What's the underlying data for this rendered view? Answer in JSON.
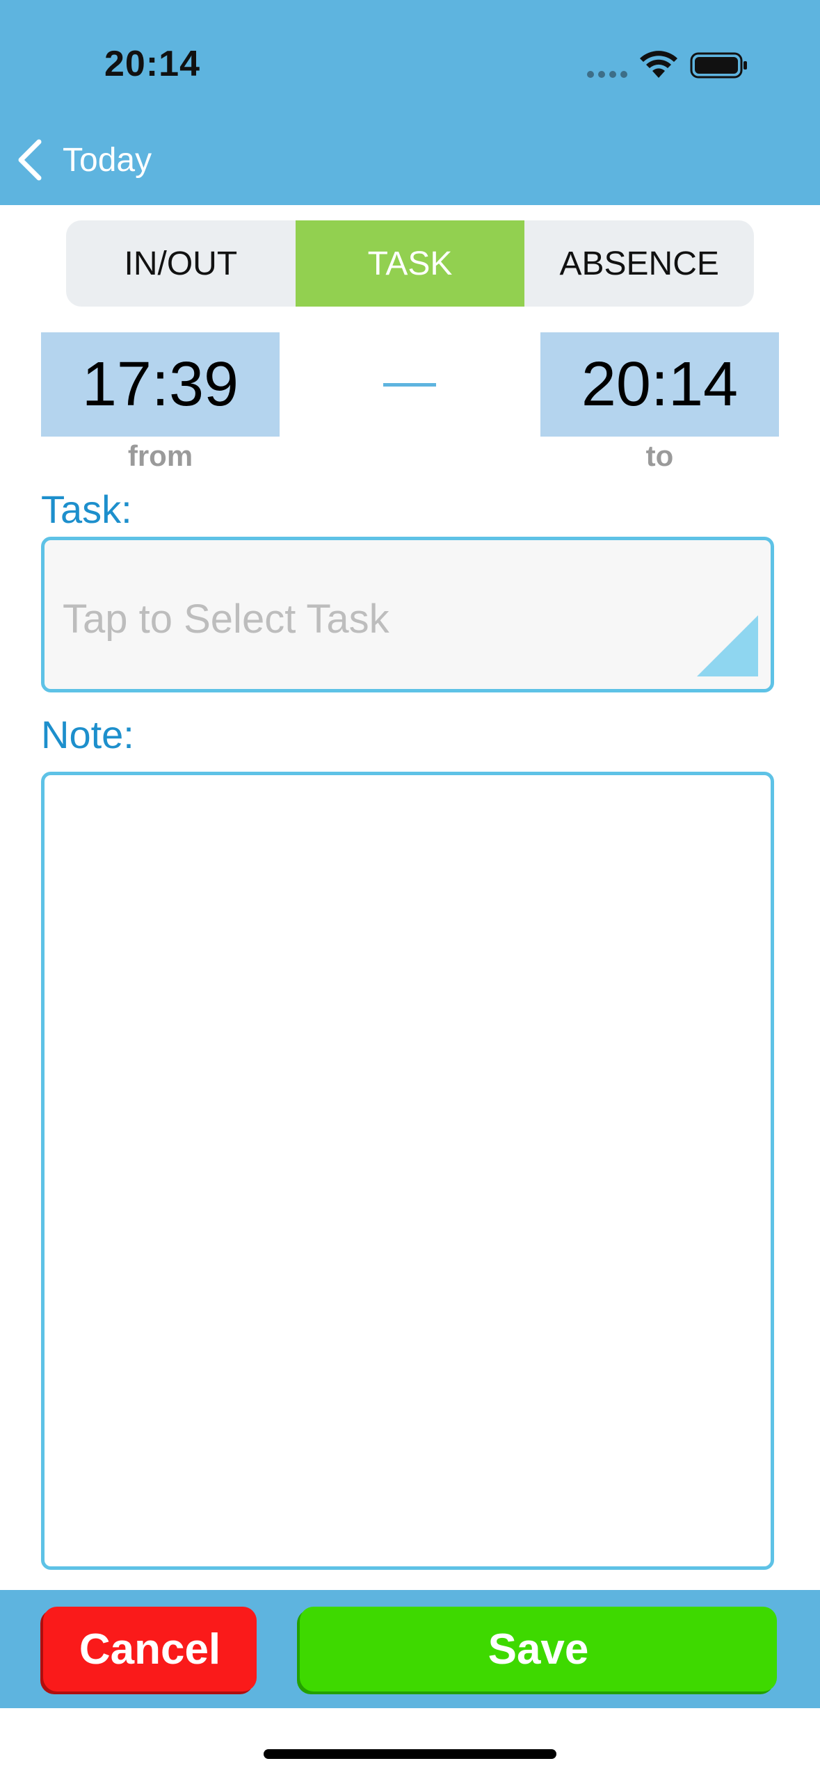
{
  "status_bar": {
    "time": "20:14"
  },
  "nav": {
    "back_label": "Today"
  },
  "segments": [
    {
      "label": "IN/OUT",
      "active": false
    },
    {
      "label": "TASK",
      "active": true
    },
    {
      "label": "ABSENCE",
      "active": false
    }
  ],
  "time_range": {
    "from_value": "17:39",
    "from_caption": "from",
    "to_value": "20:14",
    "to_caption": "to"
  },
  "task": {
    "label": "Task:",
    "placeholder": "Tap to Select Task"
  },
  "note": {
    "label": "Note:",
    "value": ""
  },
  "actions": {
    "cancel_label": "Cancel",
    "save_label": "Save"
  },
  "colors": {
    "header": "#5eb4df",
    "segment_active": "#92d050",
    "time_box": "#b4d4ee",
    "label": "#1d8fcc",
    "field_border": "#5ec2e6",
    "cancel": "#fa1a1a",
    "save": "#3ed900"
  },
  "icons": {
    "back": "chevron-left-icon",
    "wifi": "wifi-icon",
    "battery": "battery-icon",
    "signal": "cellular-signal-icon",
    "dropdown": "corner-triangle-icon"
  }
}
